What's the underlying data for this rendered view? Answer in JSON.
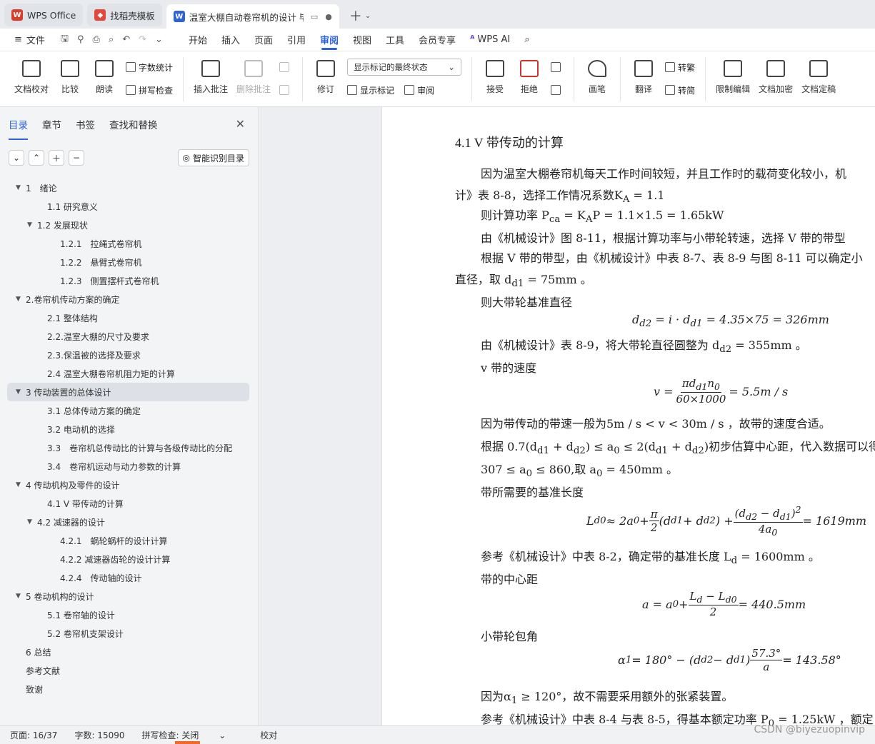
{
  "tabs": [
    {
      "label": "WPS Office",
      "icon": "wps-logo-icon",
      "color": "#d93d2b"
    },
    {
      "label": "找稻壳模板",
      "icon": "docer-icon",
      "color": "#e4463a"
    },
    {
      "label": "温室大棚自动卷帘机的设计 毕",
      "icon": "word-doc-icon",
      "color": "#2d62d8",
      "active": true
    }
  ],
  "menubar": {
    "file": "文件",
    "items": [
      "开始",
      "插入",
      "页面",
      "引用",
      "审阅",
      "视图",
      "工具",
      "会员专享"
    ],
    "active": "审阅",
    "ai": "WPS AI"
  },
  "ribbon": {
    "doc_check": "文档校对",
    "compare": "比较",
    "read": "朗读",
    "word_count": "字数统计",
    "spell_check": "拼写检查",
    "insert_comment": "插入批注",
    "delete_comment": "删除批注",
    "revise": "修订",
    "markup_state": "显示标记的最终状态",
    "show_markup": "显示标记",
    "review": "审阅",
    "accept": "接受",
    "reject": "拒绝",
    "pen": "画笔",
    "translate": "翻译",
    "to_traditional": "转繁",
    "to_simplified": "转简",
    "restrict_edit": "限制编辑",
    "encrypt": "文档加密",
    "finalize": "文档定稿"
  },
  "sidebar": {
    "tabs": [
      "目录",
      "章节",
      "书签",
      "查找和替换"
    ],
    "smart_toc": "智能识别目录",
    "toc": [
      {
        "text": "1　绪论",
        "level": "l1",
        "arrow": "▼"
      },
      {
        "text": "1.1 研究意义",
        "level": "l2"
      },
      {
        "text": "1.2 发展现状",
        "level": "l2a",
        "arrow": "▼"
      },
      {
        "text": "1.2.1　拉绳式卷帘机",
        "level": "l3"
      },
      {
        "text": "1.2.2　悬臂式卷帘机",
        "level": "l3"
      },
      {
        "text": "1.2.3　侧置摆杆式卷帘机",
        "level": "l3"
      },
      {
        "text": "2.卷帘机传动方案的确定",
        "level": "l1",
        "arrow": "▼"
      },
      {
        "text": "2.1 整体结构",
        "level": "l2"
      },
      {
        "text": "2.2.温室大棚的尺寸及要求",
        "level": "l2"
      },
      {
        "text": "2.3.保温被的选择及要求",
        "level": "l2"
      },
      {
        "text": "2.4 温室大棚卷帘机阻力矩的计算",
        "level": "l2"
      },
      {
        "text": "3 传动装置的总体设计",
        "level": "l1",
        "arrow": "▼",
        "selected": true
      },
      {
        "text": "3.1 总体传动方案的确定",
        "level": "l2"
      },
      {
        "text": "3.2 电动机的选择",
        "level": "l2"
      },
      {
        "text": "3.3　卷帘机总传动比的计算与各级传动比的分配",
        "level": "l2"
      },
      {
        "text": "3.4　卷帘机运动与动力参数的计算",
        "level": "l2"
      },
      {
        "text": "4 传动机构及零件的设计",
        "level": "l1",
        "arrow": "▼"
      },
      {
        "text": "4.1 V 带传动的计算",
        "level": "l2"
      },
      {
        "text": "4.2 减速器的设计",
        "level": "l2a",
        "arrow": "▼"
      },
      {
        "text": "4.2.1　蜗轮蜗杆的设计计算",
        "level": "l3"
      },
      {
        "text": "4.2.2 减速器齿轮的设计计算",
        "level": "l3"
      },
      {
        "text": "4.2.4　传动轴的设计",
        "level": "l3"
      },
      {
        "text": "5 卷动机构的设计",
        "level": "l1",
        "arrow": "▼"
      },
      {
        "text": "5.1 卷帘轴的设计",
        "level": "l2"
      },
      {
        "text": "5.2 卷帘机支架设计",
        "level": "l2"
      },
      {
        "text": "6 总结",
        "level": "l1"
      },
      {
        "text": "参考文献",
        "level": "l1"
      },
      {
        "text": "致谢",
        "level": "l1"
      }
    ]
  },
  "doc": {
    "heading": "4.1 V 带传动的计算",
    "p1": "因为温室大棚卷帘机每天工作时间较短，并且工作时的载荷变化较小，机",
    "p1b": "计》表 8-8，选择工作情况系数K",
    "p1b_sub": "A",
    "p1b_tail": " = 1.1",
    "p2": "则计算功率 P",
    "p2_sub": "ca",
    "p2_tail": " = K",
    "p2_sub2": "A",
    "p2_tail2": "P = 1.1×1.5 = 1.65kW",
    "p3": "由《机械设计》图 8-11，根据计算功率与小带轮转速，选择 V 带的带型",
    "p4": "根据 V 带的带型，由《机械设计》中表 8-7、表 8-9 与图 8-11 可以确定小",
    "p5": "直径，取 d",
    "p5_sub": "d1",
    "p5_tail": " = 75mm 。",
    "p6": "则大带轮基准直径",
    "f1": "d",
    "f1_sub": "d2",
    "f1_tail": " = i · d",
    "f1_sub2": "d1",
    "f1_tail2": " = 4.35×75 = 326mm",
    "p7": "由《机械设计》表 8-9，将大带轮直径圆整为 d",
    "p7_sub": "d2",
    "p7_tail": " = 355mm 。",
    "p8": "v 带的速度",
    "f2_left": "v =",
    "f2_num": "πd",
    "f2_num_sub": "d1",
    "f2_num_tail": "n",
    "f2_num_sub2": "0",
    "f2_den": "60×1000",
    "f2_right": "= 5.5m / s",
    "p9": "因为带传动的带速一般为5m / s < v < 30m / s ，故带的速度合适。",
    "p10": "根据 0.7(d",
    "p10_sub": "d1",
    "p10_mid": " + d",
    "p10_sub2": "d2",
    "p10_mid2": ") ≤ a",
    "p10_sub3": "0",
    "p10_mid3": " ≤ 2(d",
    "p10_sub4": "d1",
    "p10_mid4": " + d",
    "p10_sub5": "d2",
    "p10_tail": ")初步估算中心距，代入数据可以得到",
    "p11": "307 ≤ a",
    "p11_sub": "0",
    "p11_mid": " ≤ 860,取 a",
    "p11_sub2": "0",
    "p11_tail": " = 450mm 。",
    "p12": "带所需要的基准长度",
    "f3_left": "L",
    "f3_left_sub": "d0",
    "f3_mid": " ≈ 2a",
    "f3_mid_sub": "0",
    "f3_plus": " + ",
    "f3_pi_num": "π",
    "f3_pi_den": "2",
    "f3_sum": "(d",
    "f3_sum_sub": "d1",
    "f3_sum_mid": " + d",
    "f3_sum_sub2": "d2",
    "f3_sum_tail": ") + ",
    "f3_frac_num": "(d",
    "f3_frac_num_sub": "d2",
    "f3_frac_num_mid": " − d",
    "f3_frac_num_sub2": "d1",
    "f3_frac_num_tail": ")",
    "f3_frac_num_sup": "2",
    "f3_frac_den": "4a",
    "f3_frac_den_sub": "0",
    "f3_right": " = 1619mm",
    "p13": "参考《机械设计》中表 8-2，确定带的基准长度 L",
    "p13_sub": "d",
    "p13_tail": " = 1600mm 。",
    "p14": "带的中心距",
    "f4_left": "a = a",
    "f4_left_sub": "0",
    "f4_plus": " + ",
    "f4_num": "L",
    "f4_num_sub": "d",
    "f4_num_mid": " − L",
    "f4_num_sub2": "d0",
    "f4_den": "2",
    "f4_right": " = 440.5mm",
    "p15": "小带轮包角",
    "f5_left": "α",
    "f5_left_sub": "1",
    "f5_mid": " = 180° − (d",
    "f5_mid_sub": "d2",
    "f5_mid2": " − d",
    "f5_mid_sub2": "d1",
    "f5_mid3": ")",
    "f5_num": "57.3°",
    "f5_den": "a",
    "f5_right": " = 143.58°",
    "p16": "因为α",
    "p16_sub": "1",
    "p16_tail": " ≥ 120°，故不需要采用额外的张紧装置。",
    "p17": "参考《机械设计》中表 8-4 与表 8-5，得基本额定功率 P",
    "p17_sub": "0",
    "p17_tail": " = 1.25kW ，额定"
  },
  "status": {
    "page": "页面: 16/37",
    "words": "字数: 15090",
    "spell": "拼写检查: 关闭",
    "proof": "校对"
  },
  "watermark": "CSDN @biyezuopinvip"
}
